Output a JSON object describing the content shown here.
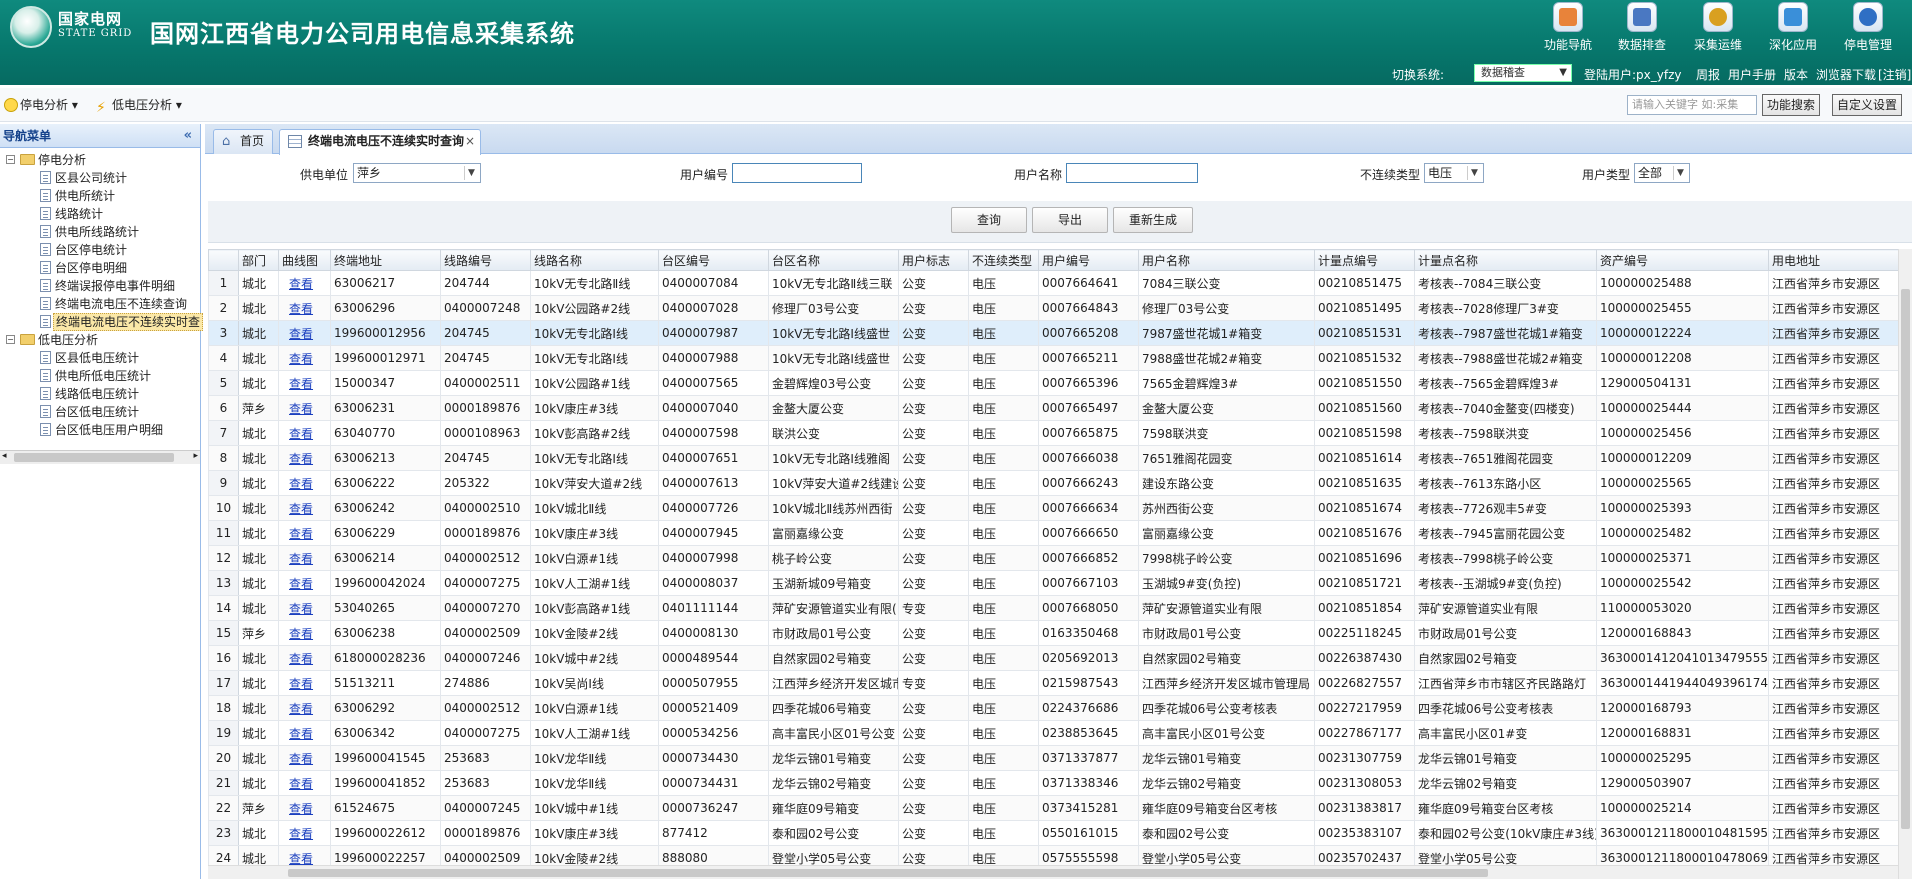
{
  "header": {
    "logo_cn": "国家电网",
    "logo_en": "STATE GRID",
    "title": "国网江西省电力公司用电信息采集系统",
    "nav": [
      {
        "label": "功能导航",
        "icon": "function-nav-icon",
        "color": "#e8833a"
      },
      {
        "label": "数据排查",
        "icon": "data-check-icon",
        "color": "#4a78c2"
      },
      {
        "label": "采集运维",
        "icon": "collect-ops-icon",
        "color": "#d9a020"
      },
      {
        "label": "深化应用",
        "icon": "deep-app-icon",
        "color": "#3a8fd9"
      },
      {
        "label": "停电管理",
        "icon": "outage-mgmt-icon",
        "color": "#2f6fc4"
      }
    ],
    "switch_label": "切换系统:",
    "switch_value": "数据稽查",
    "login_user": "登陆用户:px_yfzy",
    "links": [
      "周报",
      "用户手册",
      "版本",
      "浏览器下载",
      "[注销]"
    ]
  },
  "toolbar": {
    "outage_analysis": "停电分析",
    "low_voltage_analysis": "低电压分析",
    "keyword_placeholder": "请输入关键字 如:采集",
    "func_search": "功能搜索",
    "custom_settings": "自定义设置"
  },
  "sidebar": {
    "title": "导航菜单",
    "groups": [
      {
        "label": "停电分析",
        "items": [
          "区县公司统计",
          "供电所统计",
          "线路统计",
          "供电所线路统计",
          "台区停电统计",
          "台区停电明细",
          "终端误报停电事件明细",
          "终端电流电压不连续查询",
          "终端电流电压不连续实时查"
        ]
      },
      {
        "label": "低电压分析",
        "items": [
          "区县低电压统计",
          "供电所低电压统计",
          "线路低电压统计",
          "台区低电压统计",
          "台区低电压用户明细"
        ]
      }
    ]
  },
  "tabs": {
    "home": "首页",
    "active": "终端电流电压不连续实时查询",
    "close": "×"
  },
  "filters": {
    "unit_label": "供电单位",
    "unit_value": "萍乡",
    "user_no_label": "用户编号",
    "user_name_label": "用户名称",
    "discont_label": "不连续类型",
    "discont_value": "电压",
    "user_type_label": "用户类型",
    "user_type_value": "全部"
  },
  "actions": {
    "query": "查询",
    "export": "导出",
    "regenerate": "重新生成"
  },
  "table": {
    "columns": [
      "",
      "部门",
      "曲线图",
      "终端地址",
      "线路编号",
      "线路名称",
      "台区编号",
      "台区名称",
      "用户标志",
      "不连续类型",
      "用户编号",
      "用户名称",
      "计量点编号",
      "计量点名称",
      "资产编号",
      "用电地址"
    ],
    "rows": [
      [
        "1",
        "城北",
        "查看",
        "63006217",
        "204744",
        "10kV无专北路Ⅱ线",
        "0400007084",
        "10kV无专北路Ⅱ线三联",
        "公变",
        "电压",
        "0007664641",
        "7084三联公变",
        "00210851475",
        "考核表--7084三联公变",
        "100000025488",
        "江西省萍乡市安源区"
      ],
      [
        "2",
        "城北",
        "查看",
        "63006296",
        "0400007248",
        "10kV公园路#2线",
        "0400007028",
        "修理厂03号公变",
        "公变",
        "电压",
        "0007664843",
        "修理厂03号公变",
        "00210851495",
        "考核表--7028修理厂3#变",
        "100000025455",
        "江西省萍乡市安源区"
      ],
      [
        "3",
        "城北",
        "查看",
        "199600012956",
        "204745",
        "10kV无专北路Ⅰ线",
        "0400007987",
        "10kV无专北路Ⅰ线盛世",
        "公变",
        "电压",
        "0007665208",
        "7987盛世花城1#箱变",
        "00210851531",
        "考核表--7987盛世花城1#箱变",
        "100000012224",
        "江西省萍乡市安源区"
      ],
      [
        "4",
        "城北",
        "查看",
        "199600012971",
        "204745",
        "10kV无专北路Ⅰ线",
        "0400007988",
        "10kV无专北路Ⅰ线盛世",
        "公变",
        "电压",
        "0007665211",
        "7988盛世花城2#箱变",
        "00210851532",
        "考核表--7988盛世花城2#箱变",
        "100000012208",
        "江西省萍乡市安源区"
      ],
      [
        "5",
        "城北",
        "查看",
        "15000347",
        "0400002511",
        "10kV公园路#1线",
        "0400007565",
        "金碧辉煌03号公变",
        "公变",
        "电压",
        "0007665396",
        "7565金碧辉煌3#",
        "00210851550",
        "考核表--7565金碧辉煌3#",
        "129000504131",
        "江西省萍乡市安源区"
      ],
      [
        "6",
        "萍乡",
        "查看",
        "63006231",
        "0000189876",
        "10kV康庄#3线",
        "0400007040",
        "金鳌大厦公变",
        "公变",
        "电压",
        "0007665497",
        "金鳌大厦公变",
        "00210851560",
        "考核表--7040金鳌变(四楼变)",
        "100000025444",
        "江西省萍乡市安源区"
      ],
      [
        "7",
        "城北",
        "查看",
        "63040770",
        "0000108963",
        "10kV彭高路#2线",
        "0400007598",
        "联洪公变",
        "公变",
        "电压",
        "0007665875",
        "7598联洪变",
        "00210851598",
        "考核表--7598联洪变",
        "100000025456",
        "江西省萍乡市安源区"
      ],
      [
        "8",
        "城北",
        "查看",
        "63006213",
        "204745",
        "10kV无专北路Ⅰ线",
        "0400007651",
        "10kV无专北路Ⅰ线雅阁",
        "公变",
        "电压",
        "0007666038",
        "7651雅阁花园变",
        "00210851614",
        "考核表--7651雅阁花园变",
        "100000012209",
        "江西省萍乡市安源区"
      ],
      [
        "9",
        "城北",
        "查看",
        "63006222",
        "205322",
        "10kV萍安大道#2线",
        "0400007613",
        "10kV萍安大道#2线建设",
        "公变",
        "电压",
        "0007666243",
        "建设东路公变",
        "00210851635",
        "考核表--7613东路小区",
        "100000025565",
        "江西省萍乡市安源区"
      ],
      [
        "10",
        "城北",
        "查看",
        "63006242",
        "0400002510",
        "10kV城北Ⅱ线",
        "0400007726",
        "10kV城北Ⅱ线苏州西街",
        "公变",
        "电压",
        "0007666634",
        "苏州西街公变",
        "00210851674",
        "考核表--7726观丰5#变",
        "100000025393",
        "江西省萍乡市安源区"
      ],
      [
        "11",
        "城北",
        "查看",
        "63006229",
        "0000189876",
        "10kV康庄#3线",
        "0400007945",
        "富丽嘉缘公变",
        "公变",
        "电压",
        "0007666650",
        "富丽嘉缘公变",
        "00210851676",
        "考核表--7945富丽花园公变",
        "100000025482",
        "江西省萍乡市安源区"
      ],
      [
        "12",
        "城北",
        "查看",
        "63006214",
        "0400002512",
        "10kV白源#1线",
        "0400007998",
        "桃子岭公变",
        "公变",
        "电压",
        "0007666852",
        "7998桃子岭公变",
        "00210851696",
        "考核表--7998桃子岭公变",
        "100000025371",
        "江西省萍乡市安源区"
      ],
      [
        "13",
        "城北",
        "查看",
        "199600042024",
        "0400007275",
        "10kV人工湖#1线",
        "0400008037",
        "玉湖新城09号箱变",
        "公变",
        "电压",
        "0007667103",
        "玉湖城9#变(负控)",
        "00210851721",
        "考核表--玉湖城9#变(负控)",
        "100000025542",
        "江西省萍乡市安源区"
      ],
      [
        "14",
        "城北",
        "查看",
        "53040265",
        "0400007270",
        "10kV彭高路#1线",
        "0401111144",
        "萍矿安源管道实业有限(",
        "专变",
        "电压",
        "0007668050",
        "萍矿安源管道实业有限",
        "00210851854",
        "萍矿安源管道实业有限",
        "110000053020",
        "江西省萍乡市安源区"
      ],
      [
        "15",
        "萍乡",
        "查看",
        "63006238",
        "0400002509",
        "10kV金陵#2线",
        "0400008130",
        "市财政局01号公变",
        "公变",
        "电压",
        "0163350468",
        "市财政局01号公变",
        "00225118245",
        "市财政局01号公变",
        "120000168843",
        "江西省萍乡市安源区"
      ],
      [
        "16",
        "城北",
        "查看",
        "618000028236",
        "0400007246",
        "10kV城中#2线",
        "0000489544",
        "自然家园02号箱变",
        "公变",
        "电压",
        "0205692013",
        "自然家园02号箱变",
        "00226387430",
        "自然家园02号箱变",
        "3630001412041013479555",
        "江西省萍乡市安源区"
      ],
      [
        "17",
        "城北",
        "查看",
        "51513211",
        "274886",
        "10kV吴尚Ⅰ线",
        "0000507955",
        "江西萍乡经济开发区城市",
        "专变",
        "电压",
        "0215987543",
        "江西萍乡经济开发区城市管理局",
        "00226827557",
        "江西省萍乡市市辖区齐民路路灯",
        "3630001441944049396174",
        "江西省萍乡市安源区"
      ],
      [
        "18",
        "城北",
        "查看",
        "63006292",
        "0400002512",
        "10kV白源#1线",
        "0000521409",
        "四季花城06号箱变",
        "公变",
        "电压",
        "0224376686",
        "四季花城06号公变考核表",
        "00227217959",
        "四季花城06号公变考核表",
        "120000168793",
        "江西省萍乡市安源区"
      ],
      [
        "19",
        "城北",
        "查看",
        "63006342",
        "0400007275",
        "10kV人工湖#1线",
        "0000534256",
        "高丰富民小区01号公变",
        "公变",
        "电压",
        "0238853645",
        "高丰富民小区01号公变",
        "00227867177",
        "高丰富民小区01#变",
        "120000168831",
        "江西省萍乡市安源区"
      ],
      [
        "20",
        "城北",
        "查看",
        "199600041545",
        "253683",
        "10kV龙华Ⅱ线",
        "0000734430",
        "龙华云锦01号箱变",
        "公变",
        "电压",
        "0371337877",
        "龙华云锦01号箱变",
        "00231307759",
        "龙华云锦01号箱变",
        "100000025295",
        "江西省萍乡市安源区"
      ],
      [
        "21",
        "城北",
        "查看",
        "199600041852",
        "253683",
        "10kV龙华Ⅱ线",
        "0000734431",
        "龙华云锦02号箱变",
        "公变",
        "电压",
        "0371338346",
        "龙华云锦02号箱变",
        "00231308053",
        "龙华云锦02号箱变",
        "129000503907",
        "江西省萍乡市安源区"
      ],
      [
        "22",
        "萍乡",
        "查看",
        "61524675",
        "0400007245",
        "10kV城中#1线",
        "0000736247",
        "雍华庭09号箱变",
        "公变",
        "电压",
        "0373415281",
        "雍华庭09号箱变台区考核",
        "00231383817",
        "雍华庭09号箱变台区考核",
        "100000025214",
        "江西省萍乡市安源区"
      ],
      [
        "23",
        "城北",
        "查看",
        "199600022612",
        "0000189876",
        "10kV康庄#3线",
        "877412",
        "泰和园02号公变",
        "公变",
        "电压",
        "0550161015",
        "泰和园02号公变",
        "00235383107",
        "泰和园02号公变(10kV康庄#3线)",
        "3630001211800010481595",
        "江西省萍乡市安源区"
      ],
      [
        "24",
        "城北",
        "查看",
        "199600022257",
        "0400002509",
        "10kV金陵#2线",
        "888080",
        "登堂小学05号公变",
        "公变",
        "电压",
        "0575555598",
        "登堂小学05号公变",
        "00235702437",
        "登堂小学05号公变",
        "3630001211800010478069",
        "江西省萍乡市安源区"
      ]
    ]
  }
}
